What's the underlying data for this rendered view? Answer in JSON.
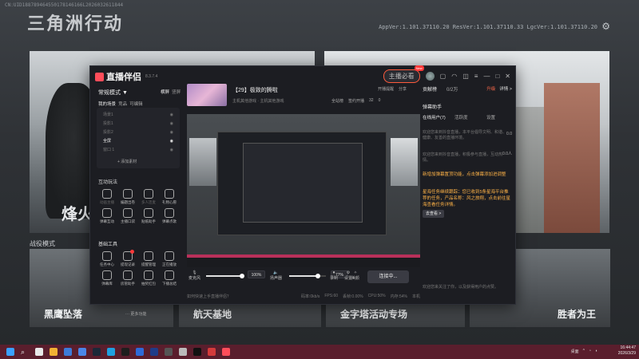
{
  "game": {
    "uid_text": "CN:UID188789464550178146166L2026032611844",
    "logo": "三角洲行动",
    "version": "AppVer:1.101.37110.20  ResVer:1.101.37110.33  LgcVer:1.101.37110.20",
    "left_panel_text": "烽火",
    "section_title": "战役模式",
    "cards": [
      "黑鹰坠落",
      "航天基地",
      "金字塔活动专场",
      "胜者为王"
    ]
  },
  "app": {
    "brand": "直播伴侣",
    "app_version": "8.3.7.4",
    "anchor_button": "主播必看",
    "new_badge": "New",
    "left": {
      "mode": "常规模式 ▼",
      "mode_tabs": {
        "a": "横屏",
        "b": "竖屏"
      },
      "scene_tabs": {
        "a": "我的场景",
        "b": "竞品",
        "c": "可编辑"
      },
      "scenes": [
        "场景1",
        "投影1",
        "投影2",
        "全屏",
        "窗口 1"
      ],
      "add_material": "+ 添加素材",
      "interact_title": "互动玩法",
      "interact": [
        "动画主播",
        "编题出卷",
        "多人连麦",
        "礼物心愿",
        "弹幕互动",
        "主播口袋",
        "贴纸助手",
        "弹幕点歌"
      ],
      "tools_title": "基础工具",
      "tools": [
        "任务中心",
        "提现记录",
        "提醒管理",
        "正在播放",
        "弹幕库",
        "房管助手",
        "抽奖红包",
        "下播总结"
      ],
      "more": "更多功能"
    },
    "room": {
      "title": "【29】极致的腾啦",
      "sub": "主机其他游戏 · 主机其他游戏",
      "actions": [
        "全站榜",
        "签约开播"
      ],
      "counts": {
        "a": "32",
        "b": "0"
      },
      "top_actions": [
        "开播提醒",
        "分享"
      ]
    },
    "controls": {
      "mic_label": "麦克风",
      "mic_pct": "100%",
      "speaker_label": "扬声器",
      "speaker_pct": "77%",
      "beauty": "美颜",
      "record": "录制",
      "settings": "设置",
      "golive": "连接中..."
    },
    "status": {
      "left": "如何快速上手直播伴侣？",
      "items": [
        "码率:0kb/s",
        "FPS:60",
        "丢帧:0.00%",
        "CPU:50%",
        "内存:54%",
        "本机"
      ]
    },
    "right": {
      "tabs": {
        "a": "贡献榜",
        "b": "0/2万"
      },
      "links": {
        "a": "升级",
        "b": "详情 >"
      },
      "dm_title": "弹幕助手",
      "dm_tabs": [
        "在线用户(7)",
        "活跃度",
        "设置"
      ],
      "notice1": "欢迎您来到抖音直播，本平台倡导文明、和谐、健康、友善的直播环境。",
      "num1": "0.0",
      "notice2": "欢迎您来到抖音直播，积极参与直播，互动热情。",
      "num2": "0.0人",
      "hl1": "新增加弹幕置顶功能，点击弹幕添加进调整",
      "hl2": "星海任务继续跟踪：您已收到5条星海平台推荐的任务，产品名称：风之旅翔，点击前往星海查看任务详情。",
      "goto": "去查看 >",
      "notice3": "欢迎您来关注了你，以及获得用户的点赞。"
    }
  },
  "taskbar": {
    "time": "16:44:47",
    "date": "2026/3/29",
    "tray_text": "桌面"
  }
}
